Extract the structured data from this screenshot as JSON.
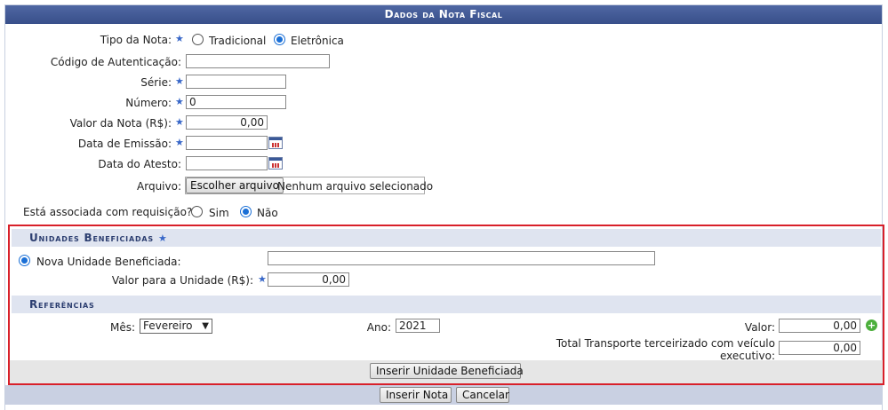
{
  "header": {
    "title": "Dados da Nota Fiscal"
  },
  "form": {
    "tipo_label": "Tipo da Nota:",
    "tipo_options": [
      "Tradicional",
      "Eletrônica"
    ],
    "tipo_selected": "Eletrônica",
    "codigo_label": "Código de Autenticação:",
    "codigo_value": "",
    "serie_label": "Série:",
    "serie_value": "",
    "numero_label": "Número:",
    "numero_value": "0",
    "valor_label": "Valor da Nota (R$):",
    "valor_value": "0,00",
    "emissao_label": "Data de Emissão:",
    "emissao_value": "",
    "atesto_label": "Data do Atesto:",
    "atesto_value": "",
    "arquivo_label": "Arquivo:",
    "arquivo_button": "Escolher arquivo",
    "arquivo_status": "Nenhum arquivo selecionado",
    "requisicao_label": "Está associada com requisição?",
    "requisicao_options": [
      "Sim",
      "Não"
    ],
    "requisicao_selected": "Não"
  },
  "unidades": {
    "title": "Unidades Beneficiadas",
    "nova_label": "Nova Unidade Beneficiada:",
    "nova_value": "",
    "valor_label": "Valor para a Unidade (R$):",
    "valor_value": "0,00"
  },
  "referencias": {
    "title": "Referências",
    "mes_label": "Mês:",
    "mes_value": "Fevereiro",
    "ano_label": "Ano:",
    "ano_value": "2021",
    "valor_label": "Valor:",
    "valor_value": "0,00",
    "transporte_label_1": "Total Transporte terceirizado com veículo",
    "transporte_label_2": "executivo:",
    "transporte_value": "0,00",
    "inserir_unidade_button": "Inserir Unidade Beneficiada"
  },
  "footer": {
    "inserir_nota_button": "Inserir Nota",
    "cancelar_button": "Cancelar"
  },
  "colors": {
    "header": "#3b5998",
    "highlight_border": "#d8202a",
    "star": "#3867c8",
    "radio": "#1a6fd6"
  },
  "icons": [
    "required-star-icon",
    "calendar-icon",
    "add-plus-icon"
  ]
}
